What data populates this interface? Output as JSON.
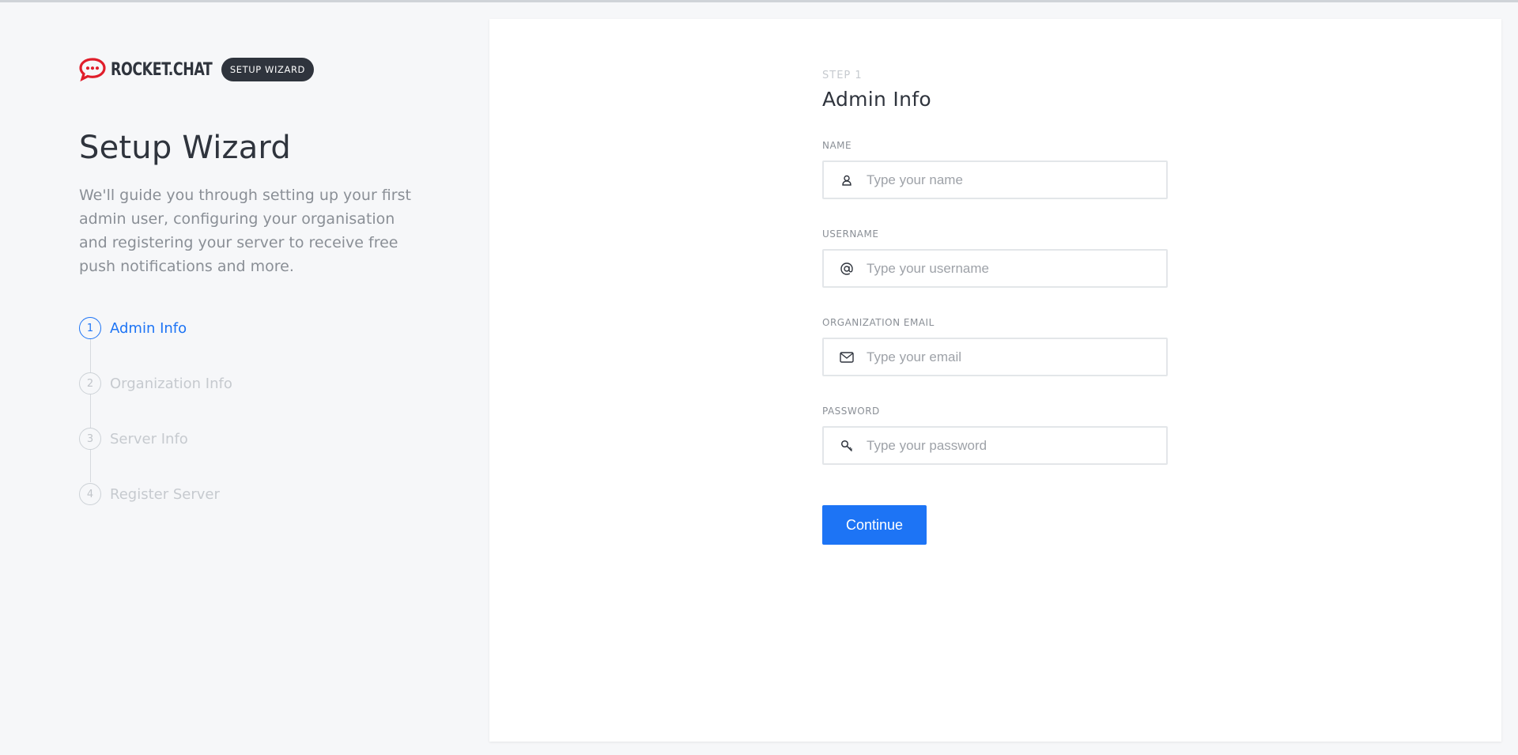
{
  "brand": {
    "wordmark": "ROCKET.CHAT",
    "badge": "SETUP WIZARD",
    "brand_color": "#e01e2b"
  },
  "sidebar": {
    "title": "Setup Wizard",
    "description": "We'll guide you through setting up your first admin user, configuring your organisation and registering your server to receive free push notifications and more.",
    "steps": [
      {
        "number": "1",
        "label": "Admin Info",
        "active": true
      },
      {
        "number": "2",
        "label": "Organization Info",
        "active": false
      },
      {
        "number": "3",
        "label": "Server Info",
        "active": false
      },
      {
        "number": "4",
        "label": "Register Server",
        "active": false
      }
    ]
  },
  "form": {
    "kicker": "STEP 1",
    "title": "Admin Info",
    "fields": [
      {
        "label": "NAME",
        "placeholder": "Type your name",
        "value": "",
        "icon": "user-icon"
      },
      {
        "label": "USERNAME",
        "placeholder": "Type your username",
        "value": "",
        "icon": "at-icon"
      },
      {
        "label": "ORGANIZATION EMAIL",
        "placeholder": "Type your email",
        "value": "",
        "icon": "mail-icon"
      },
      {
        "label": "PASSWORD",
        "placeholder": "Type your password",
        "value": "",
        "icon": "key-icon"
      }
    ],
    "continue_label": "Continue"
  },
  "colors": {
    "accent": "#1d74f5",
    "text_dark": "#2f343d",
    "text_muted": "#8a8f96",
    "inactive": "#c6cacf"
  }
}
